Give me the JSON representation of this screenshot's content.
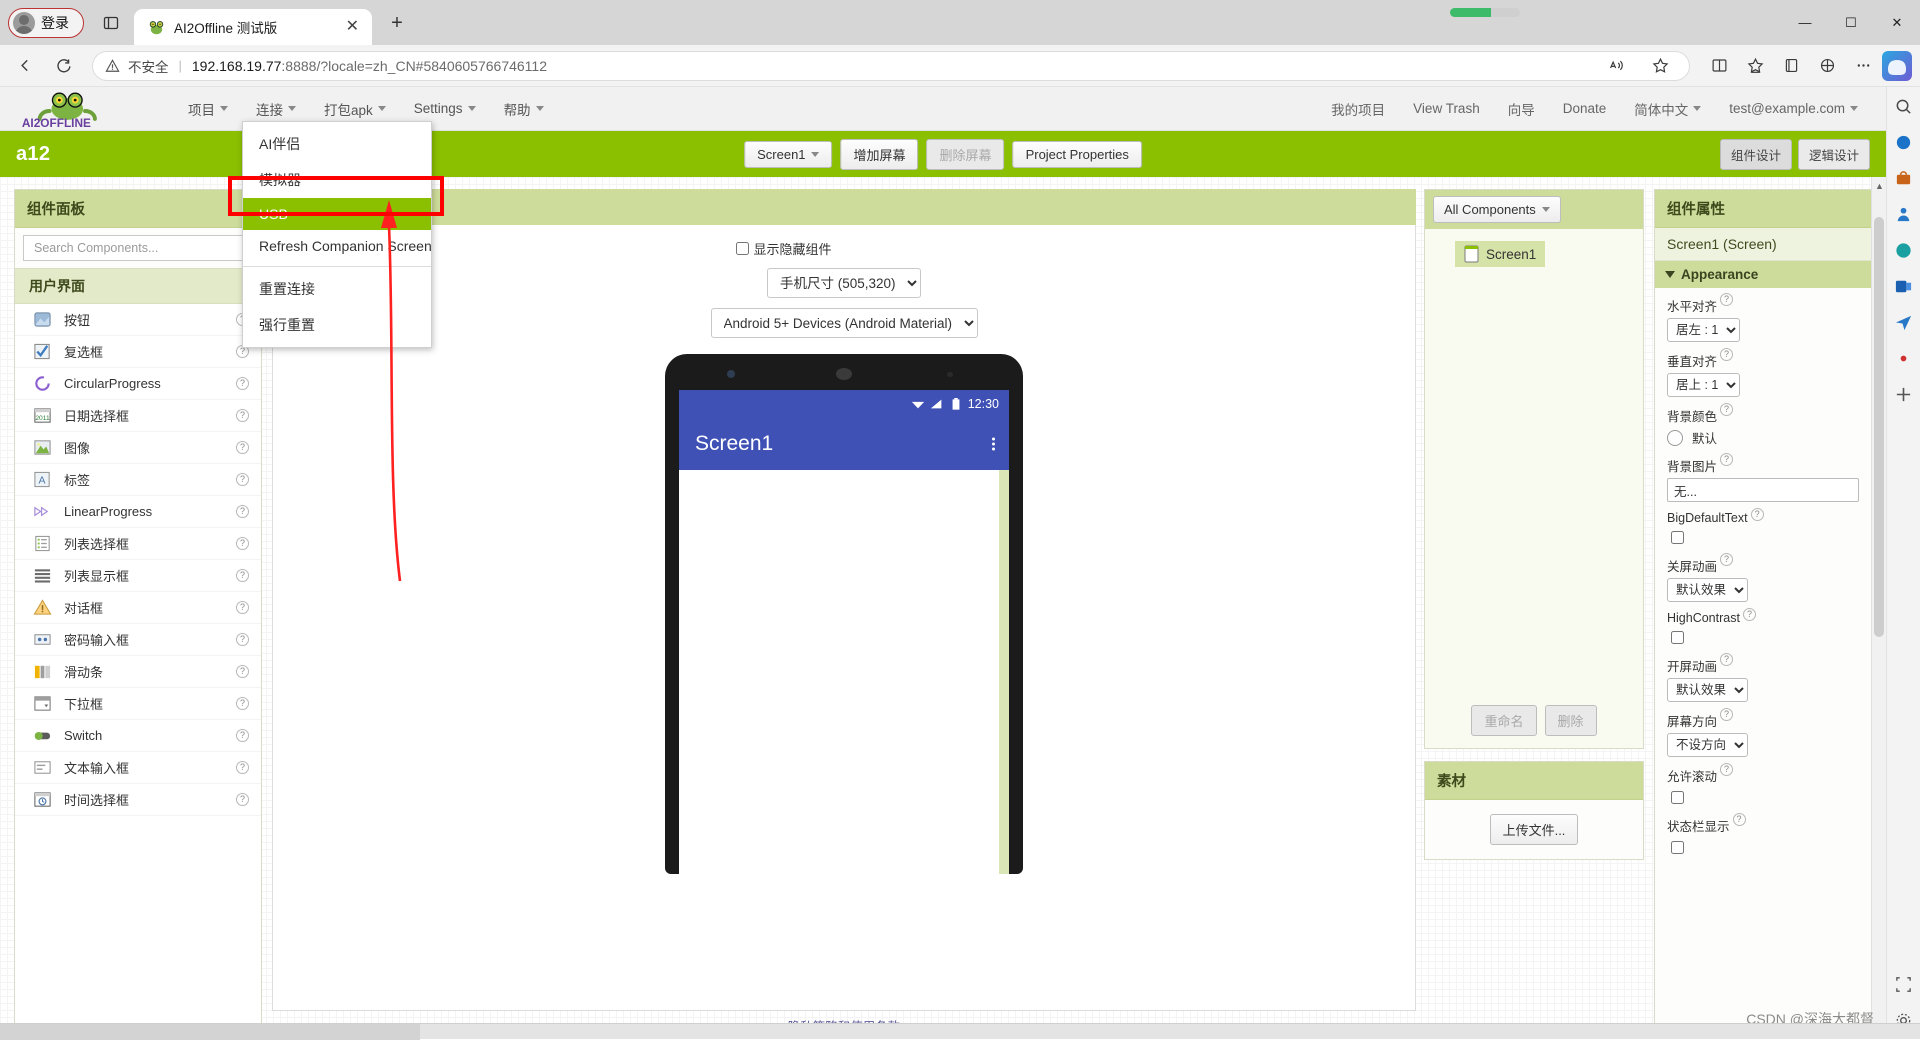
{
  "browser": {
    "profile_label": "登录",
    "tab": {
      "title": "AI2Offline 测试版",
      "close": "✕"
    },
    "new_tab": "+",
    "omnibox": {
      "warning": "不安全",
      "separator": "|",
      "url_host": "192.168.19.77",
      "url_rest": ":8888/?locale=zh_CN#5840605766746112"
    },
    "window": {
      "minimize": "—",
      "maximize": "☐",
      "close": "✕"
    }
  },
  "app": {
    "logo_text": "AI2OFFLINE",
    "menu": [
      {
        "label": "项目",
        "caret": true
      },
      {
        "label": "连接",
        "caret": true
      },
      {
        "label": "打包apk",
        "caret": true
      },
      {
        "label": "Settings",
        "caret": true
      },
      {
        "label": "帮助",
        "caret": true
      }
    ],
    "right_links": [
      {
        "label": "我的项目",
        "caret": false
      },
      {
        "label": "View Trash",
        "caret": false
      },
      {
        "label": "向导",
        "caret": false
      },
      {
        "label": "Donate",
        "caret": false
      },
      {
        "label": "简体中文",
        "caret": true
      },
      {
        "label": "test@example.com",
        "caret": true
      }
    ]
  },
  "connect_menu": {
    "items": [
      {
        "label": "AI伴侣",
        "selected": false
      },
      {
        "label": "模拟器",
        "selected": false
      },
      {
        "label": "USB",
        "selected": true
      },
      {
        "label": "Refresh Companion Screen",
        "selected": false
      }
    ],
    "items2": [
      {
        "label": "重置连接"
      },
      {
        "label": "强行重置"
      }
    ]
  },
  "project_bar": {
    "project_name": "a12",
    "screen_select": "Screen1",
    "add_screen": "增加屏幕",
    "remove_screen": "删除屏幕",
    "project_properties": "Project Properties",
    "designer_toggle": "组件设计",
    "blocks_toggle": "逻辑设计"
  },
  "palette": {
    "title": "组件面板",
    "search_placeholder": "Search Components...",
    "search_value": "",
    "category": "用户界面",
    "components": [
      {
        "label": "按钮",
        "icon": "button-icon"
      },
      {
        "label": "复选框",
        "icon": "checkbox-icon"
      },
      {
        "label": "CircularProgress",
        "icon": "circular-progress-icon"
      },
      {
        "label": "日期选择框",
        "icon": "date-picker-icon"
      },
      {
        "label": "图像",
        "icon": "image-icon"
      },
      {
        "label": "标签",
        "icon": "label-icon"
      },
      {
        "label": "LinearProgress",
        "icon": "linear-progress-icon"
      },
      {
        "label": "列表选择框",
        "icon": "list-picker-icon"
      },
      {
        "label": "列表显示框",
        "icon": "list-view-icon"
      },
      {
        "label": "对话框",
        "icon": "notifier-icon"
      },
      {
        "label": "密码输入框",
        "icon": "password-textbox-icon"
      },
      {
        "label": "滑动条",
        "icon": "slider-icon"
      },
      {
        "label": "下拉框",
        "icon": "spinner-icon"
      },
      {
        "label": "Switch",
        "icon": "switch-icon"
      },
      {
        "label": "文本输入框",
        "icon": "textbox-icon"
      },
      {
        "label": "时间选择框",
        "icon": "time-picker-icon"
      }
    ],
    "help_glyph": "?"
  },
  "viewer": {
    "show_hidden_label": "显示隐藏组件",
    "show_hidden_checked": false,
    "size_select": "手机尺寸 (505,320)",
    "theme_select": "Android 5+ Devices (Android Material)",
    "phone": {
      "status_time": "12:30",
      "screen_title": "Screen1"
    },
    "footer_link": "隐私策略和使用条款"
  },
  "tree": {
    "filter_button": "All Components",
    "nodes": [
      {
        "label": "Screen1"
      }
    ],
    "rename": "重命名",
    "delete": "删除",
    "assets_title": "素材",
    "upload_button": "上传文件..."
  },
  "properties": {
    "title": "组件属性",
    "subject": "Screen1 (Screen)",
    "section": "Appearance",
    "items": [
      {
        "label": "水平对齐",
        "type": "select",
        "value": "居左 : 1"
      },
      {
        "label": "垂直对齐",
        "type": "select",
        "value": "居上 : 1"
      },
      {
        "label": "背景颜色",
        "type": "color",
        "value": "默认"
      },
      {
        "label": "背景图片",
        "type": "text",
        "value": "无..."
      },
      {
        "label": "BigDefaultText",
        "type": "checkbox",
        "value": false
      },
      {
        "label": "关屏动画",
        "type": "select",
        "value": "默认效果"
      },
      {
        "label": "HighContrast",
        "type": "checkbox",
        "value": false
      },
      {
        "label": "开屏动画",
        "type": "select",
        "value": "默认效果"
      },
      {
        "label": "屏幕方向",
        "type": "select",
        "value": "不设方向"
      },
      {
        "label": "允许滚动",
        "type": "checkbox",
        "value": false
      },
      {
        "label": "状态栏显示",
        "type": "checkbox",
        "value": false
      }
    ],
    "help_glyph": "?"
  },
  "watermark": "CSDN @深海大都督",
  "colors": {
    "brand_green": "#8ac000",
    "panel_header": "#cddc9a",
    "android_blue": "#3f51b5",
    "annotation_red": "#ff0000"
  }
}
